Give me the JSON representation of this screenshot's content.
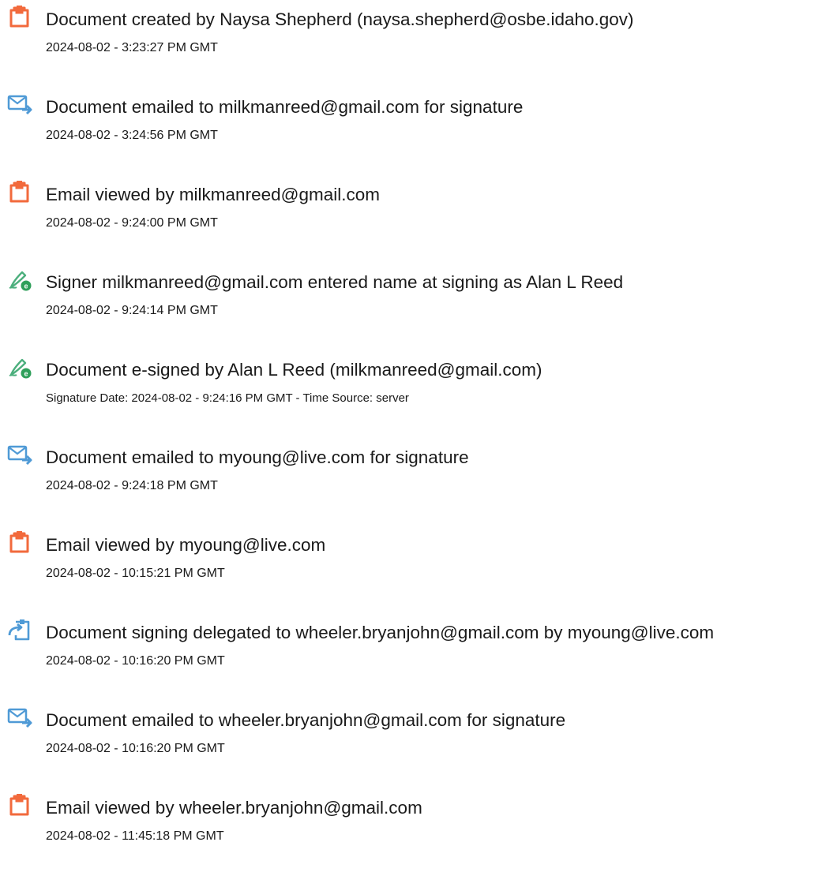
{
  "colors": {
    "doc_icon": "#f26a3c",
    "email_icon": "#4f9ad6",
    "sign_icon_pen": "#4caf7d",
    "sign_icon_badge": "#2f9f5a",
    "delegate_icon": "#4f9ad6",
    "text": "#1a1a1a"
  },
  "events": [
    {
      "icon": "document-icon",
      "title": "Document created by Naysa Shepherd (naysa.shepherd@osbe.idaho.gov)",
      "time": "2024-08-02 - 3:23:27 PM GMT"
    },
    {
      "icon": "email-sent-icon",
      "title": "Document emailed to milkmanreed@gmail.com for signature",
      "time": "2024-08-02 - 3:24:56 PM GMT"
    },
    {
      "icon": "document-icon",
      "title": "Email viewed by milkmanreed@gmail.com",
      "time": "2024-08-02 - 9:24:00 PM GMT"
    },
    {
      "icon": "esign-pen-icon",
      "title": "Signer milkmanreed@gmail.com entered name at signing as Alan L Reed",
      "time": "2024-08-02 - 9:24:14 PM GMT"
    },
    {
      "icon": "esign-pen-icon",
      "title": "Document e-signed by Alan L Reed (milkmanreed@gmail.com)",
      "time": "Signature Date: 2024-08-02 - 9:24:16 PM GMT - Time Source: server"
    },
    {
      "icon": "email-sent-icon",
      "title": "Document emailed to myoung@live.com for signature",
      "time": "2024-08-02 - 9:24:18 PM GMT"
    },
    {
      "icon": "document-icon",
      "title": "Email viewed by myoung@live.com",
      "time": "2024-08-02 - 10:15:21 PM GMT"
    },
    {
      "icon": "delegate-icon",
      "title": "Document signing delegated to wheeler.bryanjohn@gmail.com by myoung@live.com",
      "time": "2024-08-02 - 10:16:20 PM GMT"
    },
    {
      "icon": "email-sent-icon",
      "title": "Document emailed to wheeler.bryanjohn@gmail.com for signature",
      "time": "2024-08-02 - 10:16:20 PM GMT"
    },
    {
      "icon": "document-icon",
      "title": "Email viewed by wheeler.bryanjohn@gmail.com",
      "time": "2024-08-02 - 11:45:18 PM GMT"
    }
  ]
}
